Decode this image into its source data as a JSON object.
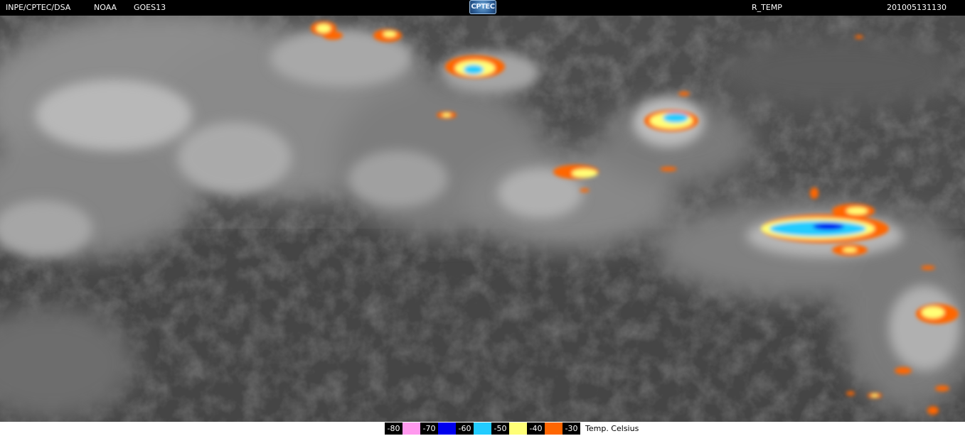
{
  "header": {
    "agency": "INPE/CPTEC/DSA",
    "source": "NOAA",
    "satellite": "GOES13",
    "logo_text": "CPTEC",
    "product": "R_TEMP",
    "datetime": "201005131130"
  },
  "legend": {
    "items": [
      {
        "label": "-80",
        "color": "#ff99ee"
      },
      {
        "label": "-70",
        "color": "#0000ee"
      },
      {
        "label": "-60",
        "color": "#22ccff"
      },
      {
        "label": "-50",
        "color": "#ffff77"
      },
      {
        "label": "-40",
        "color": "#ff6600"
      },
      {
        "label": "-30",
        "color": ""
      }
    ],
    "unit": "Temp. Celsius"
  },
  "imagery": {
    "description_icon": "satellite-infrared-image",
    "colors": {
      "background": "#4a4a4a",
      "cloud_light": "#cfcfcf",
      "cloud_mid": "#9a9a9a",
      "orange": "#ff6600",
      "yellow": "#ffff77",
      "cyan": "#22ccff",
      "blue": "#0000ee",
      "pink": "#ff99ee"
    }
  }
}
